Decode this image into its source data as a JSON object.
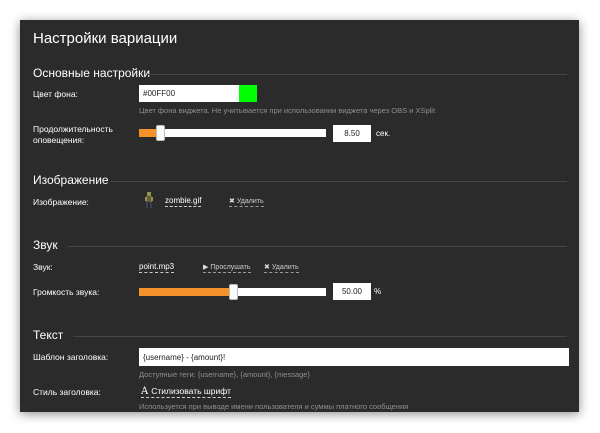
{
  "window": {
    "title": "Настройки вариации"
  },
  "sections": {
    "main": {
      "heading": "Основные настройки"
    },
    "image": {
      "heading": "Изображение"
    },
    "sound": {
      "heading": "Звук"
    },
    "text": {
      "heading": "Текст"
    }
  },
  "background": {
    "label": "Цвет фона:",
    "value": "#00FF00",
    "swatch_color": "#00ff00",
    "hint": "Цвет фона виджета. Не учитывается при использовании виджета через OBS и XSplit"
  },
  "duration": {
    "label_line1": "Продолжительность",
    "label_line2": "оповещения:",
    "value": "8.50",
    "unit": "сек.",
    "slider_fraction": 0.11
  },
  "image_field": {
    "label": "Изображение:",
    "file": "zombie.gif",
    "delete_label": "Удалить"
  },
  "sound_field": {
    "label": "Звук:",
    "file": "point.mp3",
    "listen_label": "Прослушать",
    "delete_label": "Удалить"
  },
  "volume": {
    "label": "Громкость звука:",
    "value": "50.00",
    "unit": "%",
    "slider_fraction": 0.5
  },
  "title_template": {
    "label": "Шаблон заголовка:",
    "value": "{username} - {amount}!",
    "hint": "Доступные теги: {username}, {amount}, {message}"
  },
  "title_style": {
    "label": "Стиль заголовка:",
    "button_label": "Стилизовать шрифт",
    "hint": "Используется при выводе имени пользователя и суммы платного сообщения"
  },
  "colors": {
    "panel": "#2b2b2b",
    "accent": "#f5922a",
    "muted": "#8f8f8f"
  }
}
